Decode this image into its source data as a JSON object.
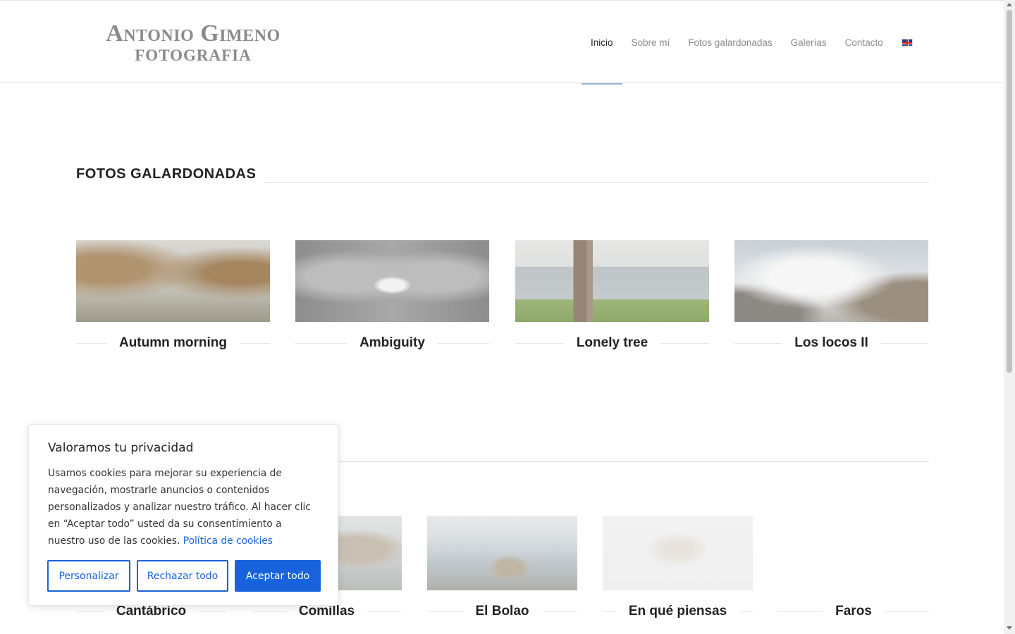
{
  "logo": {
    "line1": "Antonio Gimeno",
    "line2": "FOTOGRAFIA"
  },
  "nav": {
    "items": [
      "Inicio",
      "Sobre mí",
      "Fotos galardonadas",
      "Galerías",
      "Contacto"
    ],
    "active": "Inicio",
    "language_icon": "uk-flag-icon"
  },
  "awards": {
    "title": "FOTOS GALARDONADAS",
    "items": [
      "Autumn morning",
      "Ambiguity",
      "Lonely tree",
      "Los locos II"
    ]
  },
  "galleries": {
    "items": [
      "Cantábrico",
      "Comillas",
      "El Bolao",
      "En qué piensas",
      "Faros"
    ]
  },
  "cookie": {
    "title": "Valoramos tu privacidad",
    "text": "Usamos cookies para mejorar su experiencia de navegación, mostrarle anuncios o contenidos personalizados y analizar nuestro tráfico. Al hacer clic en “Aceptar todo” usted da su consentimiento a nuestro uso de las cookies.",
    "link": "Política de cookies",
    "buttons": {
      "customize": "Personalizar",
      "reject": "Rechazar todo",
      "accept": "Aceptar todo"
    }
  },
  "colors": {
    "accent": "#1863dc",
    "nav_underline": "#8fb3cf",
    "logo": "#8a8a8a"
  }
}
